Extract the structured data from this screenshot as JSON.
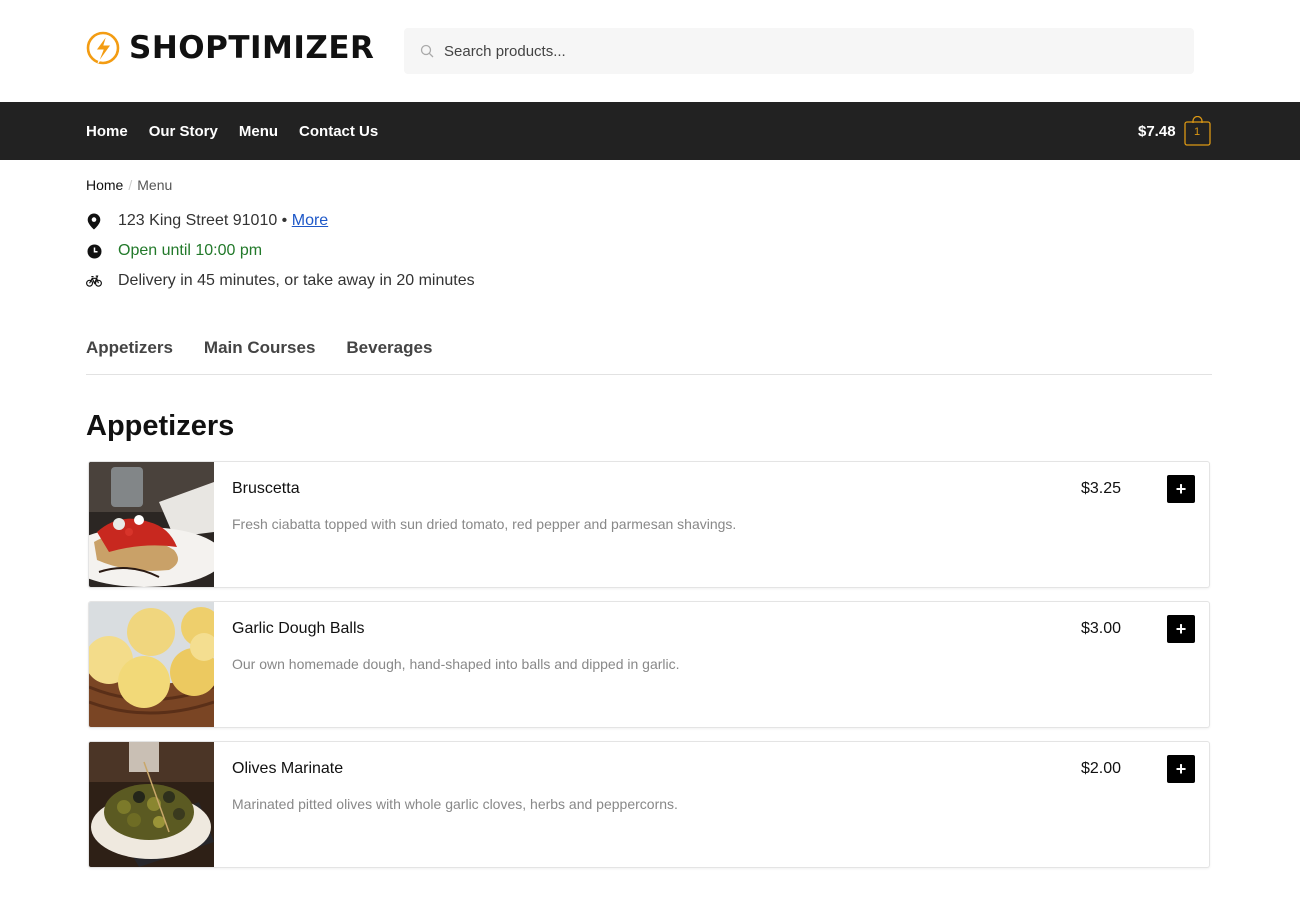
{
  "brand": {
    "name": "SHOPTIMIZER",
    "accent": "#f39c12"
  },
  "search": {
    "placeholder": "Search products...",
    "value": ""
  },
  "nav": {
    "items": [
      {
        "label": "Home"
      },
      {
        "label": "Our Story"
      },
      {
        "label": "Menu"
      },
      {
        "label": "Contact Us"
      }
    ]
  },
  "cart": {
    "total": "$7.48",
    "count": "1",
    "icon": "shopping-bag-icon",
    "color": "#dc9814"
  },
  "breadcrumb": {
    "home": "Home",
    "separator": "/",
    "current": "Menu"
  },
  "info": {
    "address": "123 King Street 91010 •",
    "more_link": "More",
    "hours": "Open until 10:00 pm",
    "delivery": "Delivery in 45 minutes, or take away in 20 minutes",
    "hours_color": "#22792a"
  },
  "tabs": [
    {
      "label": "Appetizers"
    },
    {
      "label": "Main Courses"
    },
    {
      "label": "Beverages"
    }
  ],
  "section": {
    "title": "Appetizers",
    "items": [
      {
        "name": "Bruscetta",
        "description": "Fresh ciabatta topped with sun dried tomato, red pepper and parmesan shavings.",
        "price": "$3.25",
        "add_label": "+"
      },
      {
        "name": "Garlic Dough Balls",
        "description": "Our own homemade dough, hand-shaped into balls and dipped in garlic.",
        "price": "$3.00",
        "add_label": "+"
      },
      {
        "name": "Olives Marinate",
        "description": "Marinated pitted olives with whole garlic cloves, herbs and peppercorns.",
        "price": "$2.00",
        "add_label": "+"
      }
    ]
  }
}
